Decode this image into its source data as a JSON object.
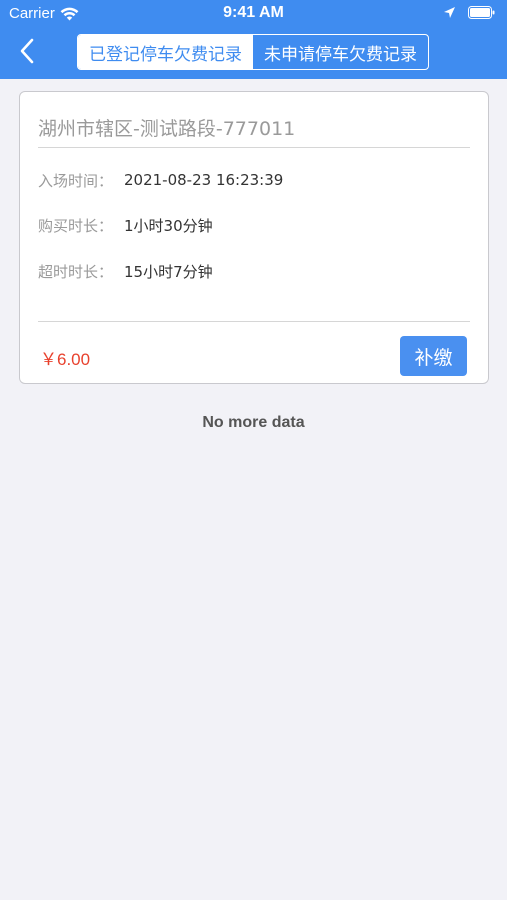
{
  "status_bar": {
    "carrier": "Carrier",
    "time": "9:41 AM",
    "icons": [
      "wifi-icon",
      "location-arrow-icon",
      "battery-icon"
    ]
  },
  "header": {
    "back_icon": "chevron-left-icon",
    "tabs": [
      {
        "label": "已登记停车欠费记录",
        "active": true
      },
      {
        "label": "未申请停车欠费记录",
        "active": false
      }
    ],
    "accent_color": "#3f8cf0"
  },
  "records": [
    {
      "title": "湖州市辖区-测试路段-777011",
      "rows": [
        {
          "label": "入场时间：",
          "value": "2021-08-23 16:23:39"
        },
        {
          "label": "购买时长：",
          "value": "1小时30分钟"
        },
        {
          "label": "超时时长：",
          "value": "15小时7分钟"
        }
      ],
      "amount": "￥6.00",
      "amount_color": "#e8412d",
      "pay_label": "补缴"
    }
  ],
  "footer": {
    "no_more": "No more data"
  }
}
